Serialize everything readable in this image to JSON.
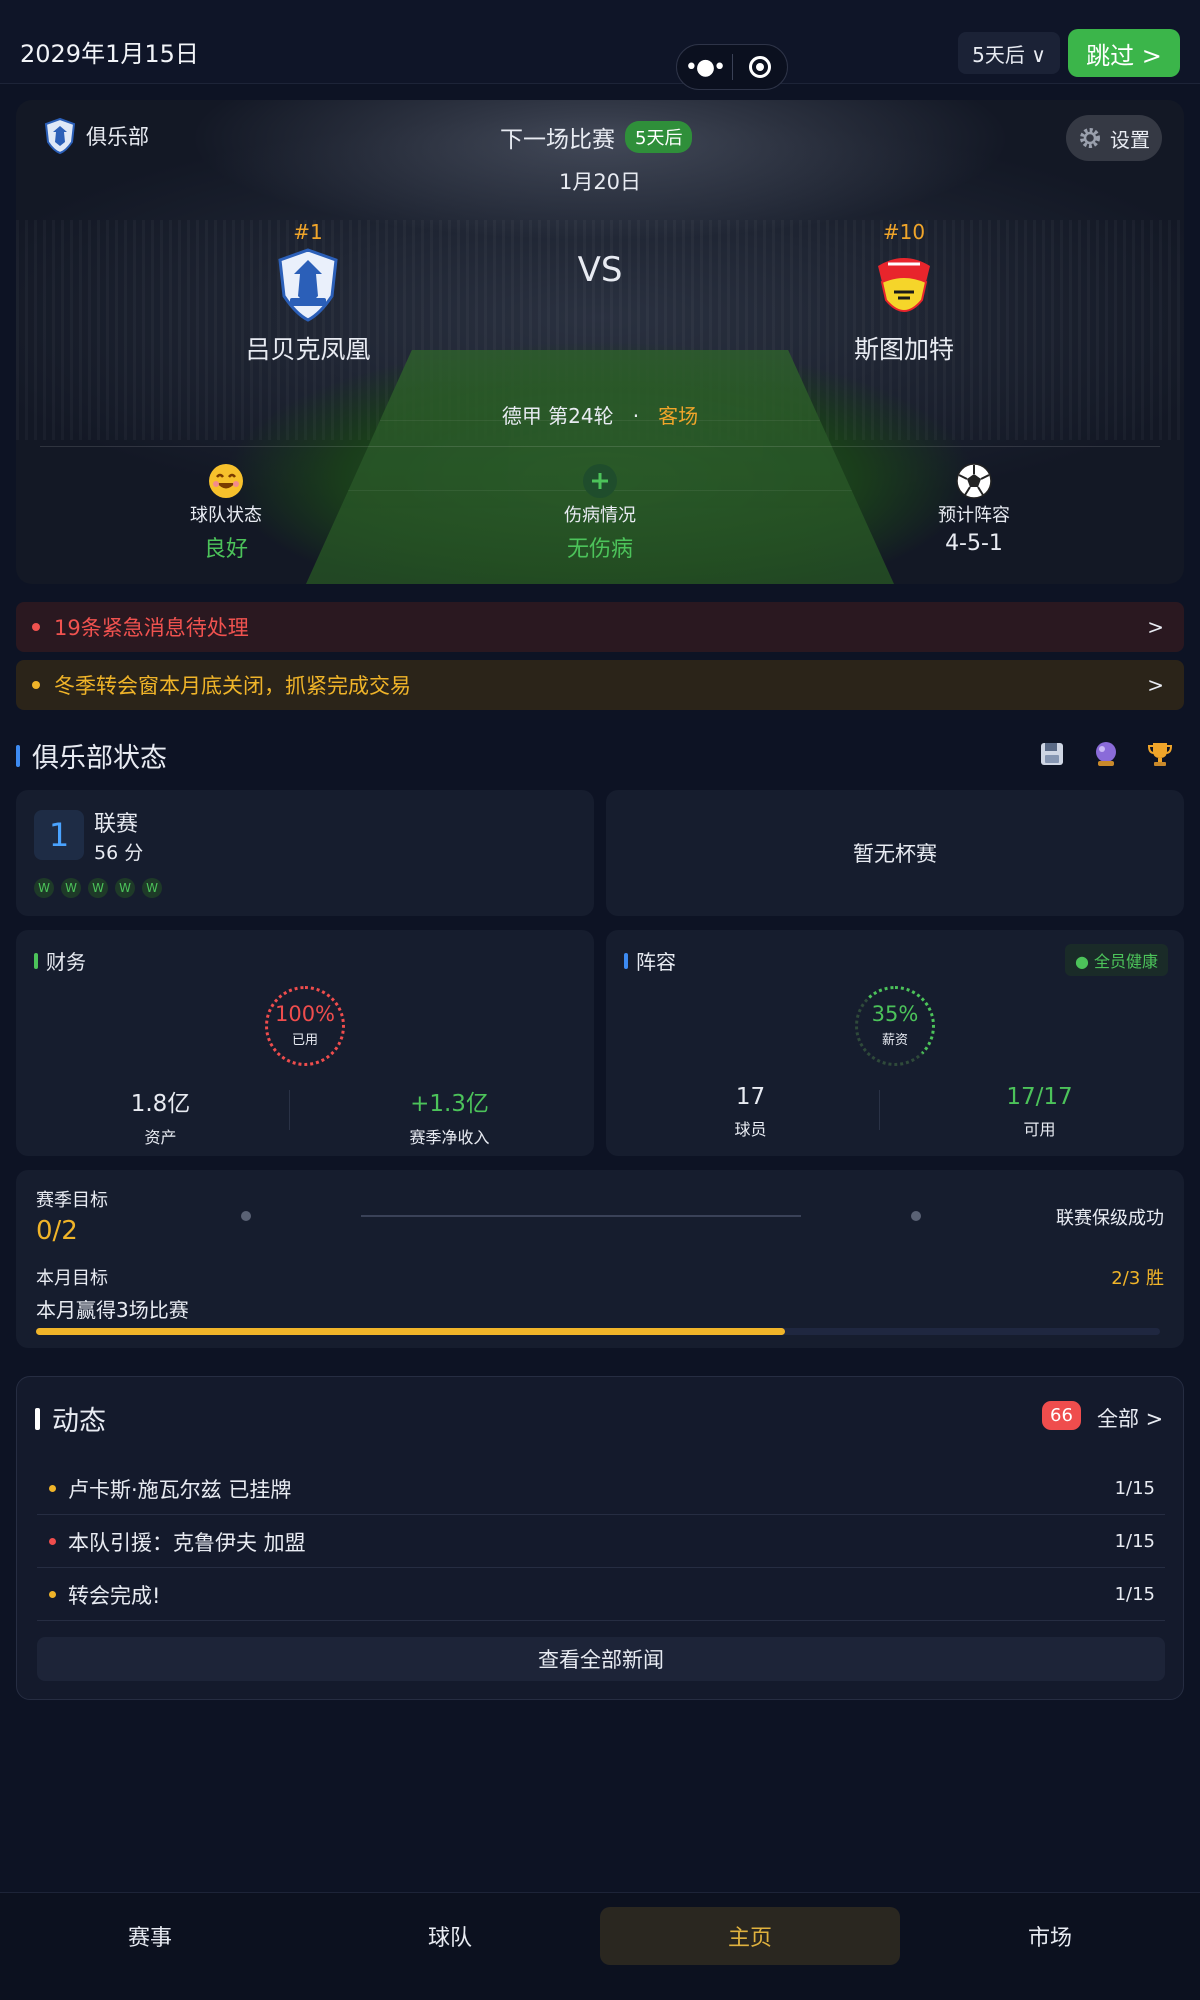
{
  "topbar": {
    "date": "2029年1月15日",
    "day_selector": "5天后 ∨",
    "skip_button": "跳过 >"
  },
  "hero": {
    "club_label": "俱乐部",
    "next_match_label": "下一场比赛",
    "days_badge": "5天后",
    "match_date": "1月20日",
    "settings_label": "设置",
    "vs": "VS",
    "home": {
      "rank": "#1",
      "name": "吕贝克凤凰"
    },
    "away": {
      "rank": "#10",
      "name": "斯图加特"
    },
    "league_round": "德甲 第24轮",
    "separator": "·",
    "venue": "客场",
    "stats": [
      {
        "label": "球队状态",
        "value": "良好"
      },
      {
        "label": "伤病情况",
        "value": "无伤病"
      },
      {
        "label": "预计阵容",
        "value": "4-5-1"
      }
    ]
  },
  "alerts": [
    {
      "text": "19条紧急消息待处理",
      "arrow": ">"
    },
    {
      "text": "冬季转会窗本月底关闭，抓紧完成交易",
      "arrow": ">"
    }
  ],
  "club_status": {
    "title": "俱乐部状态",
    "league": {
      "rank": "1",
      "name": "联赛",
      "points": "56 分",
      "form": [
        "W",
        "W",
        "W",
        "W",
        "W"
      ]
    },
    "cup": {
      "text": "暂无杯赛"
    },
    "finance": {
      "title": "财务",
      "ring_pct": "100%",
      "ring_sub": "已用",
      "ring_fraction": 1.0,
      "assets_value": "1.8亿",
      "assets_label": "资产",
      "income_value": "+1.3亿",
      "income_label": "赛季净收入"
    },
    "squad": {
      "title": "阵容",
      "health": "全员健康",
      "ring_pct": "35%",
      "ring_sub": "薪资",
      "ring_fraction": 0.35,
      "players_value": "17",
      "players_label": "球员",
      "available_value": "17/17",
      "available_label": "可用"
    }
  },
  "goals": {
    "season_label": "赛季目标",
    "season_progress": "0/2",
    "season_goal": "联赛保级成功",
    "month_label": "本月目标",
    "month_goal": "本月赢得3场比赛",
    "month_progress": "2/3 胜",
    "month_fraction": 0.6667
  },
  "news": {
    "title": "动态",
    "count": "66",
    "all_label": "全部 >",
    "items": [
      {
        "text": "卢卡斯·施瓦尔兹 已挂牌",
        "date": "1/15",
        "color": "#f0b429"
      },
      {
        "text": "本队引援：克鲁伊夫 加盟",
        "date": "1/15",
        "color": "#ef4d4d"
      },
      {
        "text": "转会完成!",
        "date": "1/15",
        "color": "#f0b429"
      }
    ],
    "view_all": "查看全部新闻"
  },
  "nav": {
    "tabs": [
      "赛事",
      "球队",
      "主页",
      "市场"
    ],
    "active": "主页"
  },
  "colors": {
    "accent_green": "#3bb54a",
    "accent_orange": "#f0a52a",
    "alert_red": "#f0524f",
    "alert_yellow": "#f0b429"
  }
}
